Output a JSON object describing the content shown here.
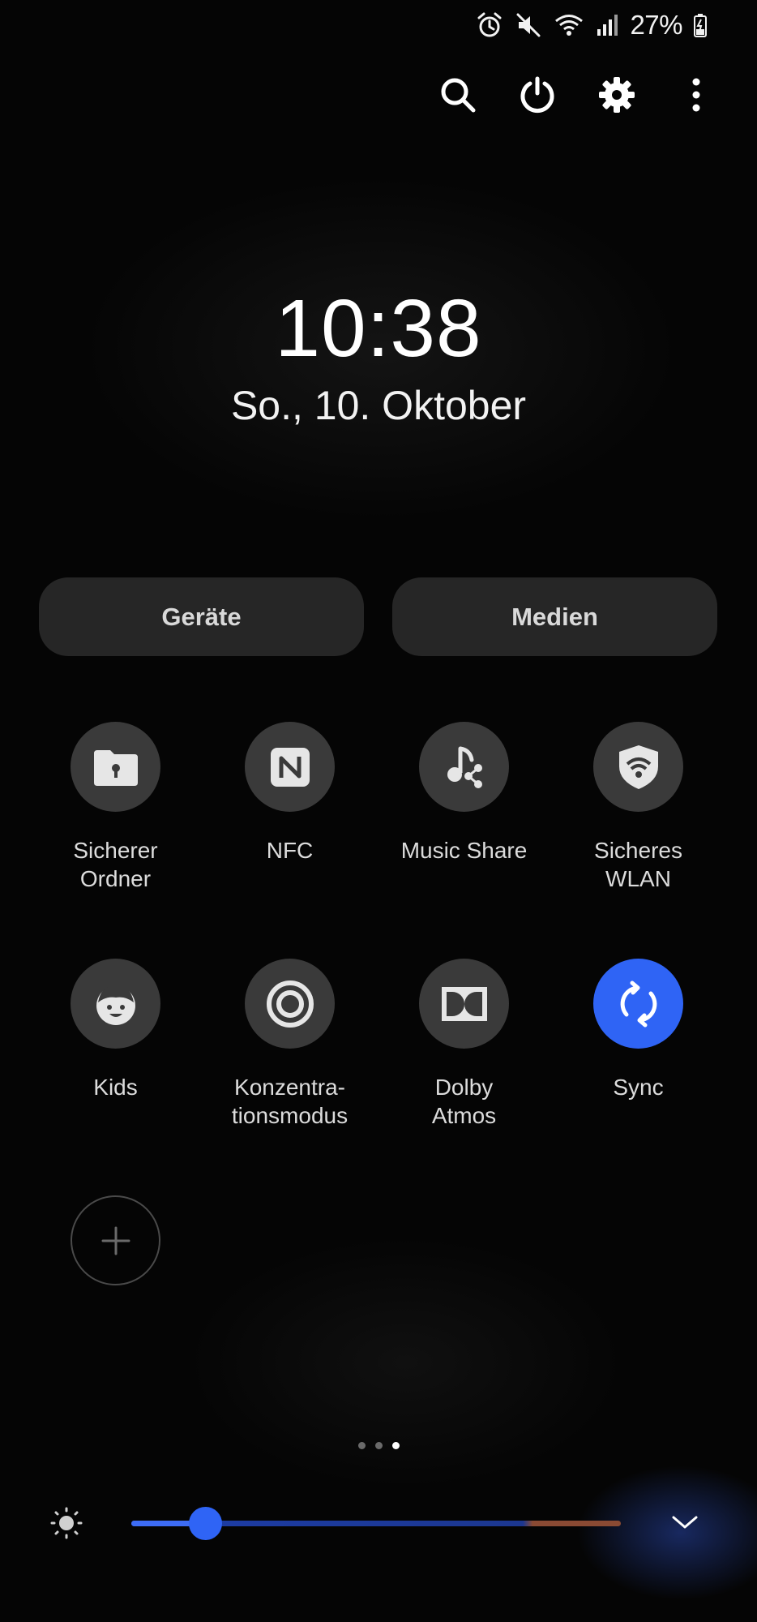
{
  "status_bar": {
    "battery_percent": "27%",
    "icons": [
      "alarm-icon",
      "mute-icon",
      "wifi-icon",
      "signal-icon",
      "battery-charging-icon"
    ]
  },
  "top_actions": [
    "search-icon",
    "power-icon",
    "gear-icon",
    "more-vert-icon"
  ],
  "clock": {
    "time": "10:38",
    "date": "So., 10. Oktober"
  },
  "buttons": {
    "devices": "Geräte",
    "media": "Medien"
  },
  "tiles": [
    {
      "label": "Sicherer\nOrdner",
      "icon": "secure-folder-icon",
      "active": false
    },
    {
      "label": "NFC",
      "icon": "nfc-icon",
      "active": false
    },
    {
      "label": "Music Share",
      "icon": "music-share-icon",
      "active": false
    },
    {
      "label": "Sicheres\nWLAN",
      "icon": "secure-wifi-icon",
      "active": false
    },
    {
      "label": "Kids",
      "icon": "kids-icon",
      "active": false
    },
    {
      "label": "Konzentra-\ntionsmodus",
      "icon": "focus-mode-icon",
      "active": false
    },
    {
      "label": "Dolby\nAtmos",
      "icon": "dolby-icon",
      "active": false
    },
    {
      "label": "Sync",
      "icon": "sync-icon",
      "active": true
    }
  ],
  "add_tile_icon": "plus-icon",
  "pager": {
    "count": 3,
    "current": 3
  },
  "brightness": {
    "level": 0.15,
    "icon": "sun-icon"
  },
  "expand_icon": "chevron-down-icon",
  "colors": {
    "accent": "#2f64f5",
    "tile_bg": "#3a3a3a",
    "pill_bg": "#262626",
    "background": "#050505"
  }
}
